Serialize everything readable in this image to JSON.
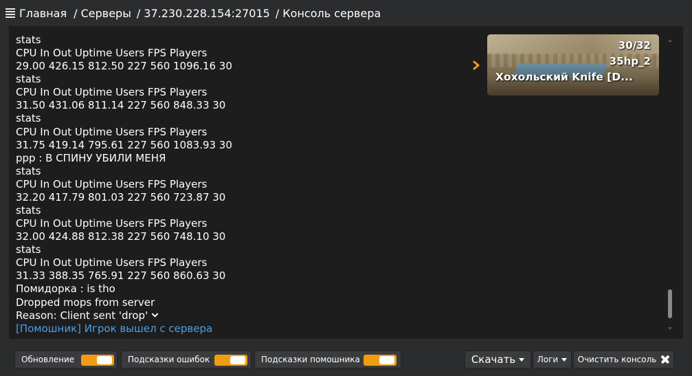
{
  "breadcrumb": {
    "home": "Главная",
    "servers": "/ Серверы",
    "address": "/ 37.230.228.154:27015",
    "page": "/ Консоль сервера"
  },
  "console": {
    "lines": [
      "stats",
      "CPU In Out Uptime Users FPS Players",
      "29.00 426.15 812.50 227 560 1096.16 30",
      "stats",
      "CPU In Out Uptime Users FPS Players",
      "31.50 431.06 811.14 227 560 848.33 30",
      "stats",
      "CPU In Out Uptime Users FPS Players",
      "31.75 419.14 795.61 227 560 1083.93 30",
      "ppp : В СПИНУ УБИЛИ МЕНЯ",
      "stats",
      "CPU In Out Uptime Users FPS Players",
      "32.20 417.79 801.03 227 560 723.87 30",
      "stats",
      "CPU In Out Uptime Users FPS Players",
      "32.00 424.88 812.38 227 560 748.10 30",
      "stats",
      "CPU In Out Uptime Users FPS Players",
      "31.33 388.35 765.91 227 560 860.63 30",
      "Помидорка : is tho",
      "Dropped mops from server",
      "Reason: Client sent 'drop'"
    ],
    "last_line": "[Помошник] Игрок вышел с сервера"
  },
  "server_card": {
    "players": "30/32",
    "map": "35hp_2",
    "name": "Хохольский Knife [D..."
  },
  "toggles": [
    {
      "label": "Обновление",
      "on": true
    },
    {
      "label": "Подсказки ошибок",
      "on": true
    },
    {
      "label": "Подсказки помошника",
      "on": true
    }
  ],
  "actions": {
    "download": "Скачать",
    "logs": "Логи",
    "clear": "Очистить консоль"
  },
  "colors": {
    "accent": "#f29c13",
    "link": "#4d9fe8",
    "console_bg": "#1d1d1d",
    "page_bg": "#2b2c2e"
  }
}
